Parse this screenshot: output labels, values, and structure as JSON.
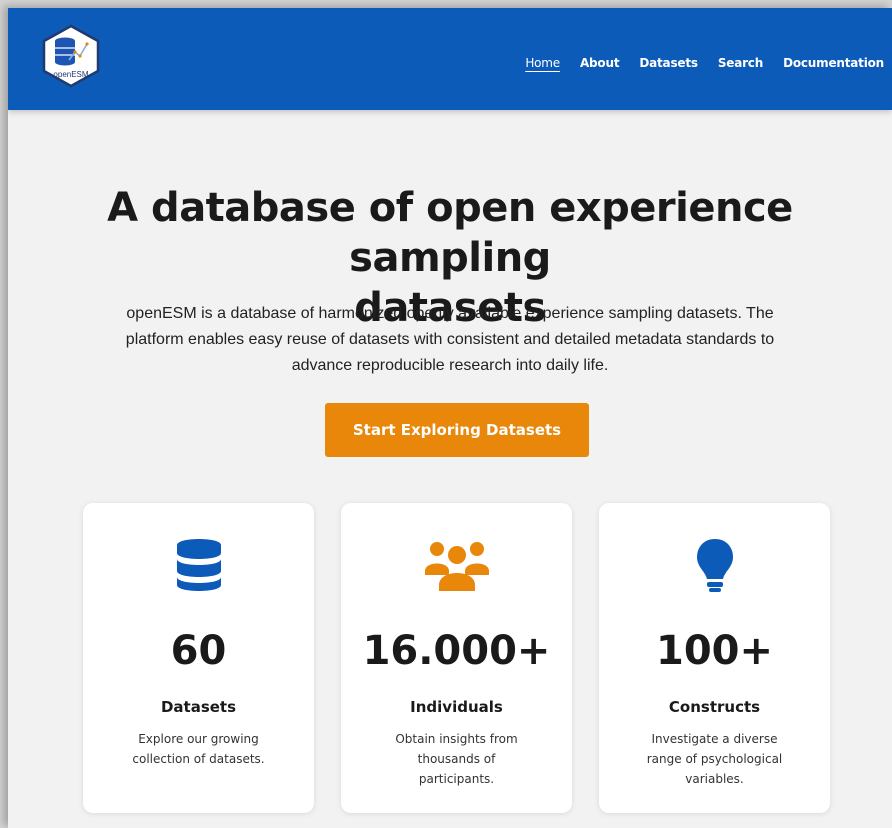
{
  "brand": {
    "logo_text": "openESM",
    "primary_color": "#0d5bb8",
    "accent_color": "#e8870a"
  },
  "nav": {
    "items": [
      {
        "label": "Home",
        "active": true
      },
      {
        "label": "About",
        "active": false
      },
      {
        "label": "Datasets",
        "active": false
      },
      {
        "label": "Search",
        "active": false
      },
      {
        "label": "Documentation",
        "active": false
      }
    ]
  },
  "hero": {
    "title_line1": "A database of open experience sampling",
    "title_line2": "datasets",
    "description": "openESM is a database of harmonized openly available experience sampling datasets. The platform enables easy reuse of datasets with consistent and detailed metadata standards to advance reproducible research into daily life.",
    "cta_label": "Start Exploring Datasets"
  },
  "stats": [
    {
      "icon": "database-icon",
      "value": "60",
      "label": "Datasets",
      "description": "Explore our growing collection of datasets."
    },
    {
      "icon": "users-icon",
      "value": "16.000+",
      "label": "Individuals",
      "description": "Obtain insights from thousands of participants."
    },
    {
      "icon": "lightbulb-icon",
      "value": "100+",
      "label": "Constructs",
      "description": "Investigate a diverse range of psychological variables."
    }
  ]
}
